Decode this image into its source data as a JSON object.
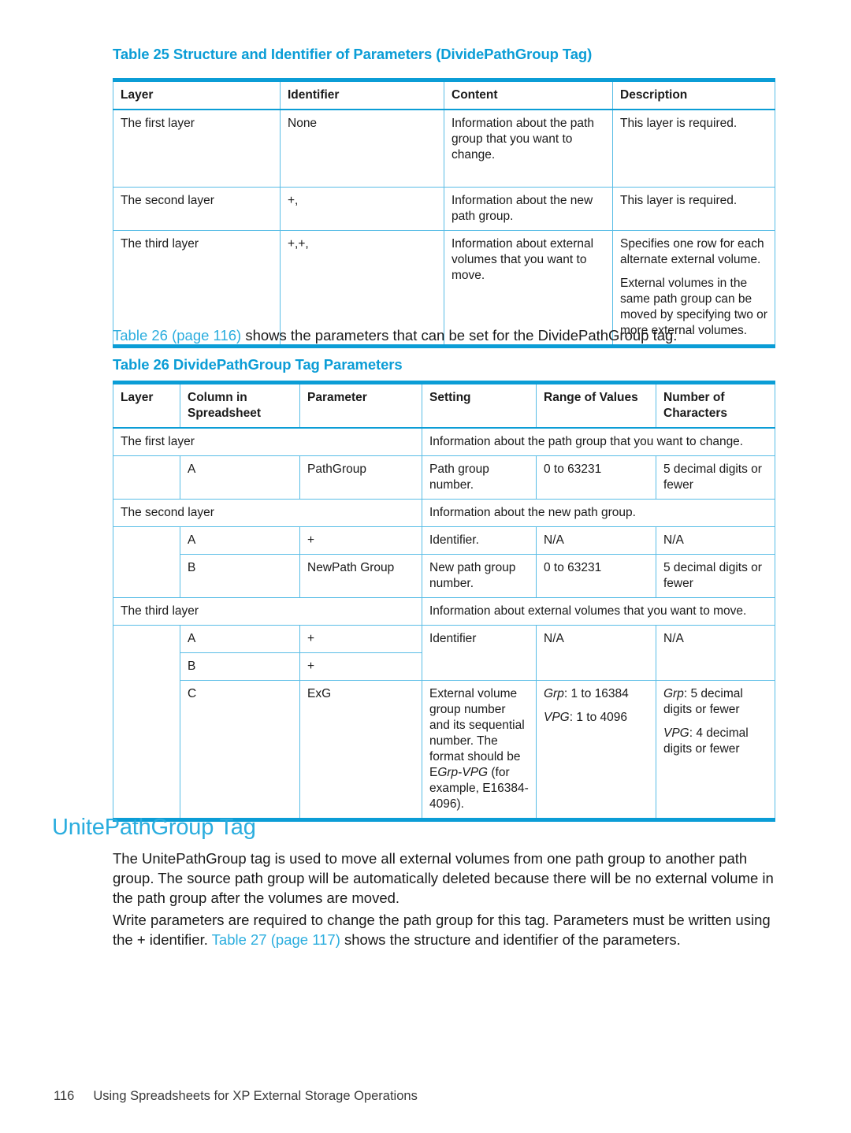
{
  "page": {
    "number": "116",
    "footer_title": "Using Spreadsheets for XP External Storage Operations",
    "accent_color": "#0b9dd6",
    "link_color": "#2badde"
  },
  "table25": {
    "caption": "Table 25 Structure and Identifier of Parameters (DividePathGroup Tag)",
    "headers": [
      "Layer",
      "Identifier",
      "Content",
      "Description"
    ],
    "rows": [
      {
        "layer": "The first layer",
        "identifier": "None",
        "content": "Information about the path group that you want to change.",
        "description_paragraphs": [
          "This layer is required."
        ]
      },
      {
        "layer": "The second layer",
        "identifier": "+,",
        "content": "Information about the new path group.",
        "description_paragraphs": [
          "This layer is required."
        ]
      },
      {
        "layer": "The third layer",
        "identifier": "+,+,",
        "content": "Information about external volumes that you want to move.",
        "description_paragraphs": [
          "Specifies one row for each alternate external volume.",
          "External volumes in the same path group can be moved by specifying two or more external volumes."
        ]
      }
    ]
  },
  "intro_text": {
    "link": "Table 26 (page 116)",
    "rest": " shows the parameters that can be set for the DividePathGroup tag."
  },
  "table26": {
    "caption": "Table 26 DividePathGroup Tag Parameters",
    "headers": [
      "Layer",
      "Column in Spreadsheet",
      "Parameter",
      "Setting",
      "Range of Values",
      "Number of Characters"
    ],
    "groups": [
      {
        "layer": "The first layer",
        "summary": "Information about the path group that you want to change.",
        "rows": [
          {
            "column": "A",
            "parameter": "PathGroup",
            "setting": "Path group number.",
            "range": "0 to 63231",
            "chars": "5 decimal digits or fewer"
          }
        ]
      },
      {
        "layer": "The second layer",
        "summary": "Information about the new path group.",
        "rows": [
          {
            "column": "A",
            "parameter": "+",
            "setting": "Identifier.",
            "range": "N/A",
            "chars": "N/A"
          },
          {
            "column": "B",
            "parameter": "NewPath Group",
            "setting": "New path group number.",
            "range": "0 to 63231",
            "chars": "5 decimal digits or fewer"
          }
        ]
      },
      {
        "layer": "The third layer",
        "summary": "Information about external volumes that you want to move.",
        "rows": [
          {
            "column": "A",
            "parameter": "+",
            "setting": "Identifier",
            "range": "N/A",
            "chars": "N/A"
          },
          {
            "column": "B",
            "parameter": "+"
          },
          {
            "column": "C",
            "parameter": "ExG",
            "setting_parts": {
              "lead": "External volume group number and its sequential number. The format should be E",
              "italic1": "Grp",
              "mid": "-",
              "italic2": "VPG",
              "tail": " (for example, E16384-4096)."
            },
            "range_lines": [
              {
                "italic": "Grp",
                "text": ": 1 to 16384"
              },
              {
                "italic": "VPG",
                "text": ": 1 to 4096"
              }
            ],
            "chars_lines": [
              {
                "italic": "Grp",
                "text": ": 5 decimal digits or fewer"
              },
              {
                "italic": "VPG",
                "text": ": 4 decimal digits or fewer"
              }
            ]
          }
        ]
      }
    ]
  },
  "section": {
    "heading": "UnitePathGroup Tag",
    "paragraph1": "The UnitePathGroup tag is used to move all external volumes from one path group to another path group. The source path group will be automatically deleted because there will be no external volume in the path group after the volumes are moved.",
    "paragraph2_lead": "Write parameters are required to change the path group for this tag. Parameters must be written using the + identifier. ",
    "paragraph2_link": "Table 27 (page 117)",
    "paragraph2_rest": " shows the structure and identifier of the parameters."
  }
}
